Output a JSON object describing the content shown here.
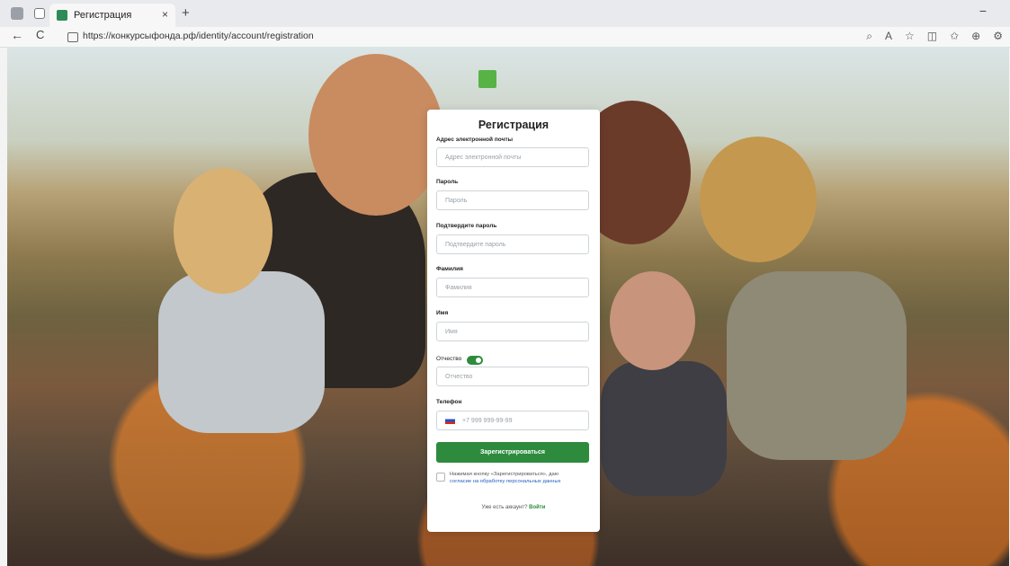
{
  "browser": {
    "tab_title": "Регистрация",
    "tab_close": "×",
    "new_tab": "+",
    "minimize": "−",
    "back": "←",
    "reload": "C",
    "url": "https://конкурсыфонда.рф/identity/account/registration",
    "toolbar_icons": [
      "zoom-icon",
      "read-aloud-icon",
      "favorite-star-icon",
      "split-screen-icon",
      "favorites-icon",
      "collections-icon",
      "extensions-icon"
    ]
  },
  "form": {
    "title": "Регистрация",
    "fields": [
      {
        "label": "Адрес электронной почты",
        "placeholder": "Адрес электронной почты"
      },
      {
        "label": "Пароль",
        "placeholder": "Пароль"
      },
      {
        "label": "Подтвердите пароль",
        "placeholder": "Подтвердите пароль"
      },
      {
        "label": "Фамилия",
        "placeholder": "Фамилия"
      },
      {
        "label": "Имя",
        "placeholder": "Имя"
      },
      {
        "label": "Отчество",
        "placeholder": "Отчество"
      },
      {
        "label": "Телефон",
        "placeholder": "+7 999 999-99-99"
      }
    ],
    "patronymic_toggle_on": true,
    "submit_label": "Зарегистрироваться",
    "consent_text": "Нажимая кнопку «Зарегистрироваться», даю",
    "consent_link": "согласие на обработку персональных данных",
    "login_prompt": "Уже есть аккаунт?",
    "login_link": "Войти"
  },
  "colors": {
    "accent": "#2e8b3e",
    "link": "#1f5fbf"
  }
}
